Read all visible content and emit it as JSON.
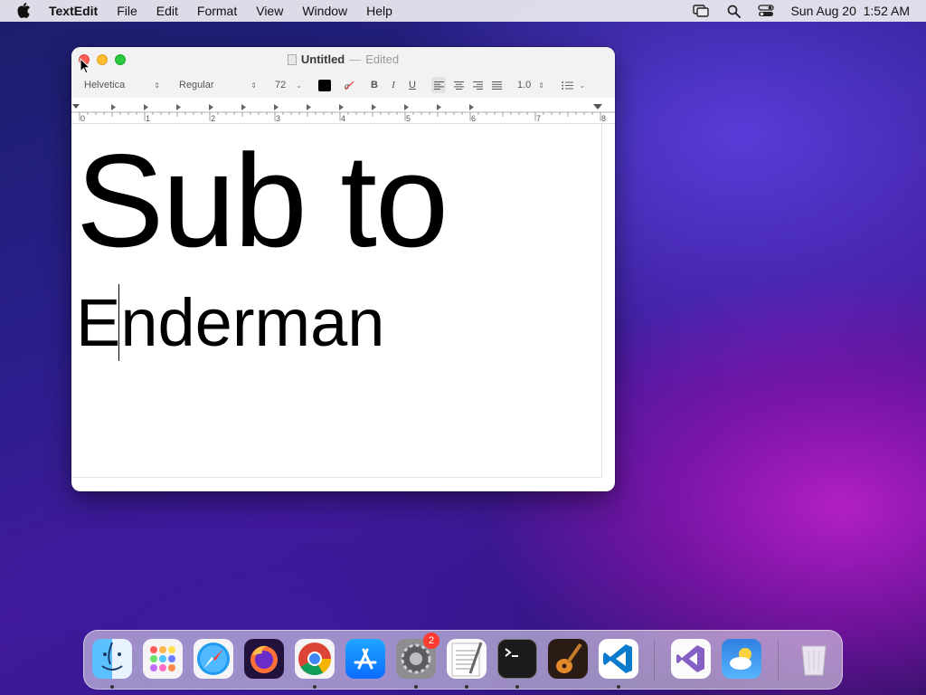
{
  "menubar": {
    "app_name": "TextEdit",
    "menus": [
      "File",
      "Edit",
      "Format",
      "View",
      "Window",
      "Help"
    ],
    "clock": "Sun Aug 20  1:52 AM",
    "status_icons": [
      "screen-mirroring-icon",
      "search-icon",
      "control-center-icon"
    ]
  },
  "window": {
    "title": "Untitled",
    "separator": "—",
    "status": "Edited",
    "toolbar": {
      "font_family": "Helvetica",
      "font_style": "Regular",
      "font_size": "72",
      "text_color": "#000000",
      "bold": "B",
      "italic": "I",
      "underline": "U",
      "line_spacing": "1.0"
    },
    "ruler": {
      "labels": [
        "0",
        "1",
        "2",
        "3",
        "4",
        "5",
        "6",
        "7",
        "8"
      ]
    },
    "document": {
      "line1": "Sub to",
      "line2": "Enderman"
    }
  },
  "dock": {
    "apps": [
      {
        "name": "Finder",
        "running": true
      },
      {
        "name": "Launchpad",
        "running": false
      },
      {
        "name": "Safari",
        "running": false
      },
      {
        "name": "Firefox",
        "running": false
      },
      {
        "name": "Chrome",
        "running": true
      },
      {
        "name": "App Store",
        "running": false
      },
      {
        "name": "System Settings",
        "running": true,
        "badge": "2"
      },
      {
        "name": "TextEdit",
        "running": true
      },
      {
        "name": "Terminal",
        "running": true
      },
      {
        "name": "GarageBand",
        "running": false
      },
      {
        "name": "Visual Studio Code",
        "running": true
      },
      {
        "name": "Visual Studio",
        "running": false
      },
      {
        "name": "Weather",
        "running": false
      },
      {
        "name": "Trash",
        "running": false
      }
    ]
  }
}
